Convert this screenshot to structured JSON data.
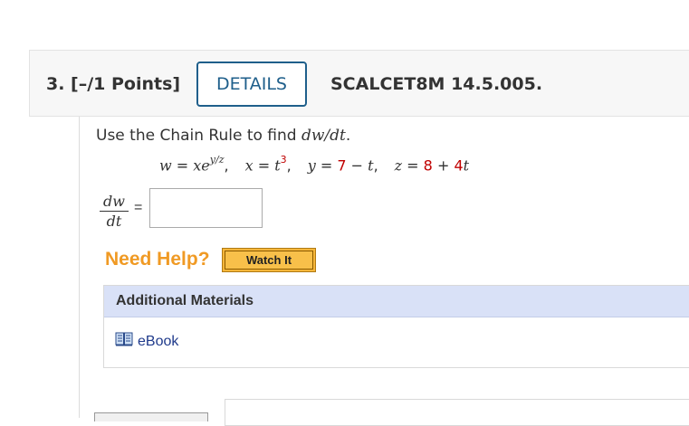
{
  "question": {
    "number_points": "3.  [–/1 Points]",
    "details_label": "DETAILS",
    "code": "SCALCET8M 14.5.005."
  },
  "prompt": {
    "prefix": "Use the Chain Rule to find ",
    "var": "dw/dt",
    "suffix": "."
  },
  "equation": {
    "w_lhs": "w",
    "w_rhs_base": "xe",
    "w_rhs_exp": "y/z",
    "x_lhs": "x",
    "x_rhs_base": "t",
    "x_rhs_exp": "3",
    "y_lhs": "y",
    "y_const": "7",
    "y_rest": "t",
    "z_lhs": "z",
    "z_const": "8",
    "z_coef": "4",
    "z_var": "t"
  },
  "answer": {
    "frac_num": "dw",
    "frac_den": "dt",
    "equals": "=",
    "value": ""
  },
  "help": {
    "need_help": "Need Help?",
    "watch_label": "Watch It"
  },
  "materials": {
    "heading": "Additional Materials",
    "ebook_label": "eBook",
    "ebook_icon": "book-icon"
  }
}
